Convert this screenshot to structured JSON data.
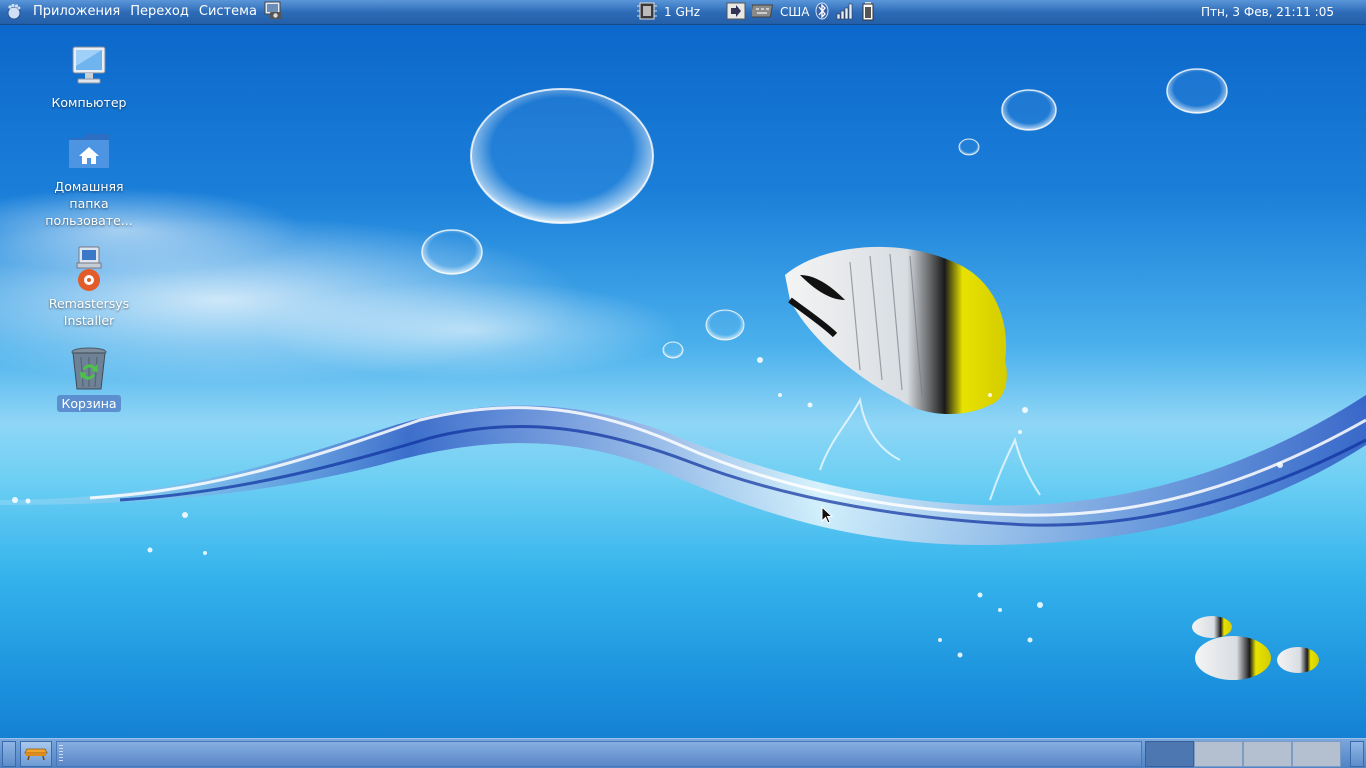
{
  "top_panel": {
    "menu": {
      "logo_icon": "gnome-foot-icon",
      "applications": "Приложения",
      "places": "Переход",
      "system": "Система",
      "launcher_icon": "screenshot-tool-icon"
    },
    "cpu_freq": "1 GHz",
    "keyboard_layout": "США",
    "tray_icons": [
      "cpu-chip-icon",
      "network-manager-icon",
      "keyboard-icon",
      "bluetooth-icon",
      "signal-strength-icon",
      "battery-icon"
    ],
    "clock": "Птн,  3 Фев, 21:11 :05"
  },
  "desktop": {
    "icons": [
      {
        "label": "Компьютер",
        "icon": "computer-icon",
        "selected": false
      },
      {
        "label": "Домашняя папка пользовате...",
        "icon": "home-folder-icon",
        "selected": false
      },
      {
        "label": "Remastersys Installer",
        "icon": "installer-icon",
        "selected": false
      },
      {
        "label": "Корзина",
        "icon": "trash-icon",
        "selected": true
      }
    ]
  },
  "bottom_panel": {
    "launcher_icon": "show-desktop-icon",
    "workspaces": [
      {
        "name": "workspace-1",
        "active": true
      },
      {
        "name": "workspace-2",
        "active": false
      },
      {
        "name": "workspace-3",
        "active": false
      },
      {
        "name": "workspace-4",
        "active": false
      }
    ]
  },
  "colors": {
    "panel": "#2e6cb8",
    "wallpaper_top": "#0a64c8",
    "wallpaper_horizon": "#8fd6f6",
    "selection": "#5b8fd0"
  }
}
